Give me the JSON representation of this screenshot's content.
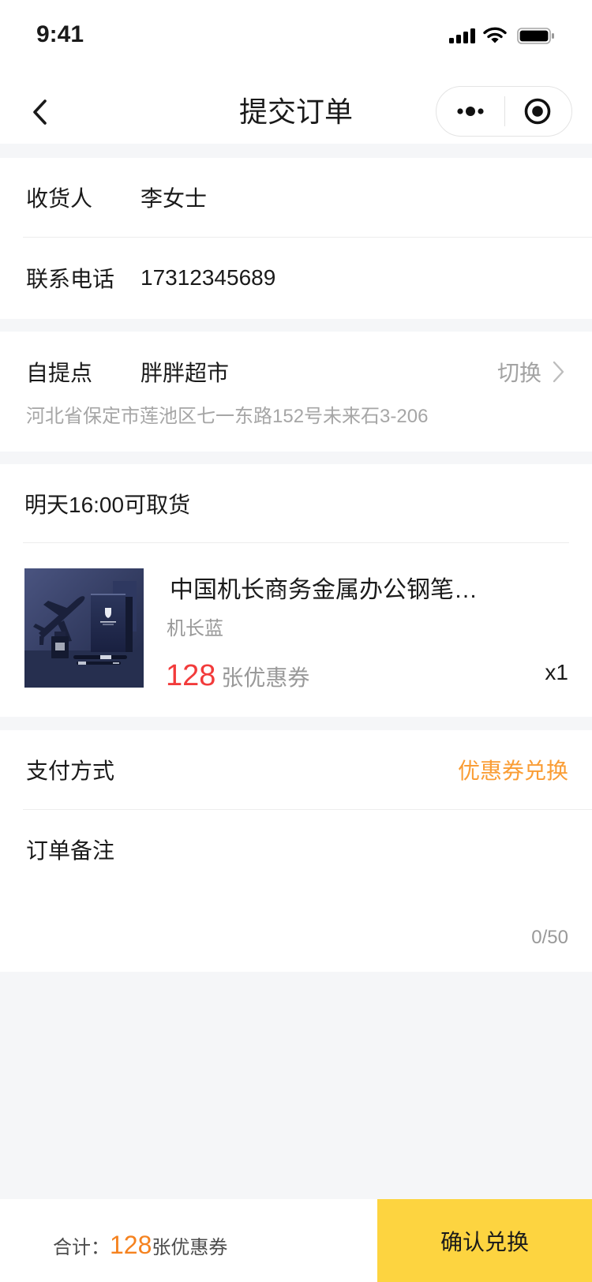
{
  "status_bar": {
    "time": "9:41",
    "icons": [
      "signal-icon",
      "wifi-icon",
      "battery-icon"
    ]
  },
  "nav": {
    "title": "提交订单",
    "back_icon": "chevron-left-icon",
    "capsule_icons": [
      "more-dots-icon",
      "target-icon"
    ]
  },
  "recipient": {
    "name_label": "收货人",
    "name_value": "李女士",
    "phone_label": "联系电话",
    "phone_value": "17312345689"
  },
  "pickup": {
    "label": "自提点",
    "store_name": "胖胖超市",
    "switch_label": "切换",
    "switch_icon": "chevron-right-icon",
    "address": "河北省保定市莲池区七一东路152号未来石3-206"
  },
  "order_item": {
    "pickup_time": "明天16:00可取货",
    "product": {
      "title": "中国机长商务金属办公钢笔…",
      "variant": "机长蓝",
      "price": "128",
      "price_unit": "张优惠券",
      "quantity": "x1"
    }
  },
  "payment": {
    "label": "支付方式",
    "value": "优惠券兑换"
  },
  "note": {
    "label": "订单备注",
    "counter": "0/50"
  },
  "footer": {
    "total_label": "合计：",
    "total_value": "128",
    "total_unit": "张优惠券",
    "confirm_label": "确认兑换"
  },
  "colors": {
    "page_background": "#F5F6F8",
    "accent_yellow": "#FDD440",
    "price_red": "#F23B3B",
    "payment_orange": "#FA9D35",
    "total_orange": "#F5821F",
    "text_primary": "#1A1A1A",
    "text_secondary": "#999999"
  }
}
